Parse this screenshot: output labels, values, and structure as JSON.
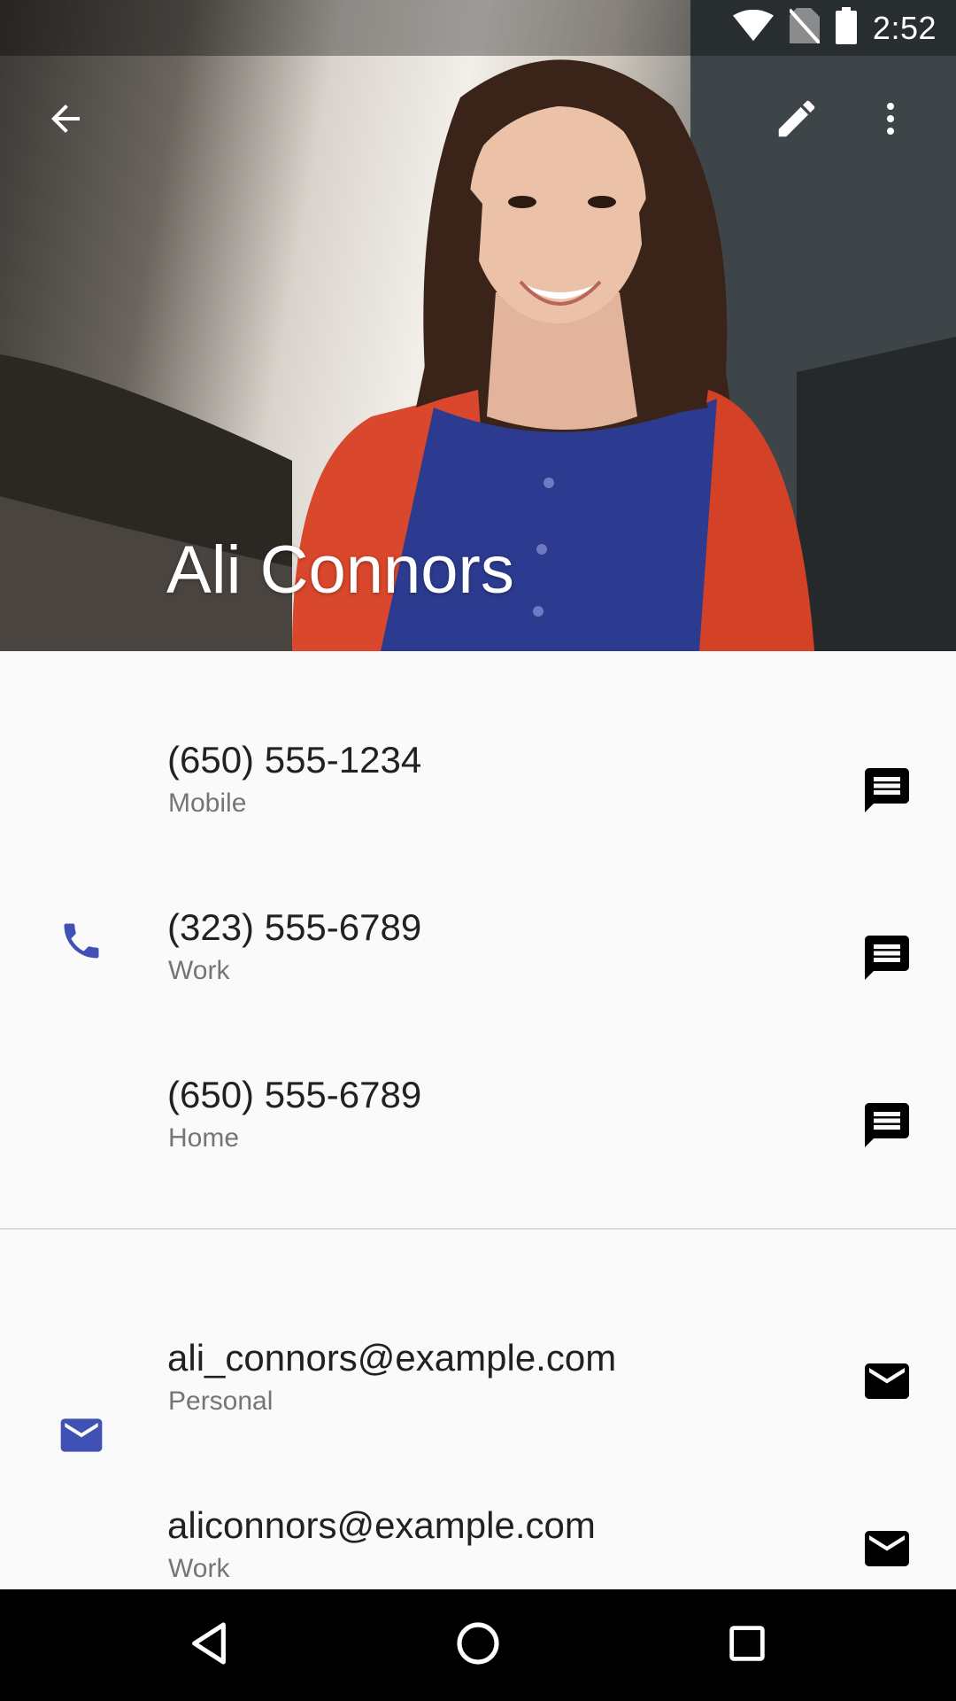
{
  "status_bar": {
    "time": "2:52"
  },
  "contact": {
    "name": "Ali Connors"
  },
  "phones": [
    {
      "number": "(650) 555-1234",
      "type": "Mobile"
    },
    {
      "number": "(323) 555-6789",
      "type": "Work"
    },
    {
      "number": "(650) 555-6789",
      "type": "Home"
    }
  ],
  "emails": [
    {
      "address": "ali_connors@example.com",
      "type": "Personal"
    },
    {
      "address": "aliconnors@example.com",
      "type": "Work"
    }
  ],
  "colors": {
    "accent": "#3f51b5",
    "primary_text": "#212121",
    "secondary_text": "#757575",
    "background": "#fafafa"
  },
  "icons": [
    "back-arrow-icon",
    "edit-pencil-icon",
    "more-vert-icon",
    "wifi-icon",
    "no-sim-icon",
    "battery-icon",
    "phone-icon",
    "message-icon",
    "email-icon",
    "nav-back-icon",
    "nav-home-icon",
    "nav-recents-icon"
  ]
}
